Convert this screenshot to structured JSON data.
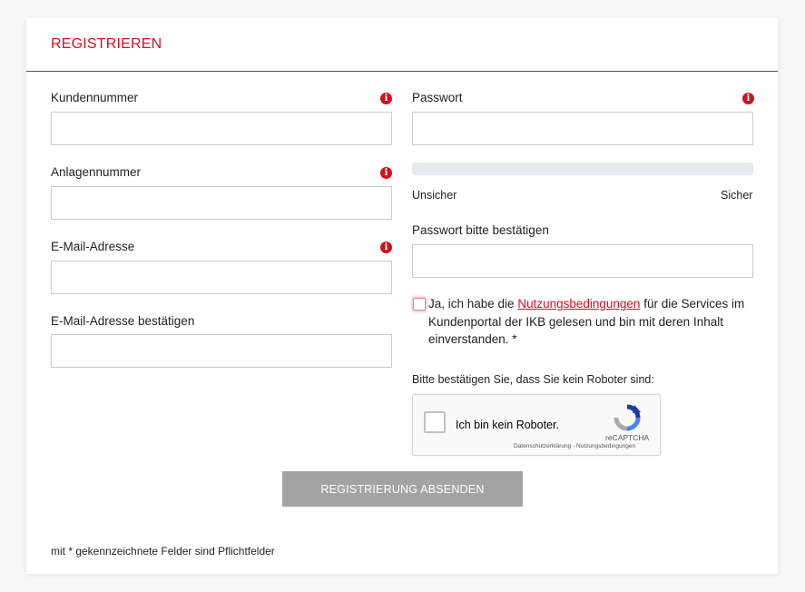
{
  "form": {
    "title": "REGISTRIEREN",
    "customer_number_label": "Kundennummer",
    "plant_number_label": "Anlagennummer",
    "email_label": "E-Mail-Adresse",
    "email_confirm_label": "E-Mail-Adresse bestätigen",
    "password_label": "Passwort",
    "strength_low": "Unsicher",
    "strength_high": "Sicher",
    "password_confirm_label": "Passwort bitte bestätigen",
    "terms_prefix": "Ja, ich habe die ",
    "terms_link": "Nutzungsbedingungen",
    "terms_suffix": " für die Services im Kundenportal der IKB gelesen und bin mit deren Inhalt einverstanden. *",
    "robot_prompt": "Bitte bestätigen Sie, dass Sie kein Roboter sind:",
    "submit_label": "REGISTRIERUNG ABSENDEN",
    "footnote": "mit * gekennzeichnete Felder sind Pflichtfelder",
    "info_glyph": "i"
  },
  "captcha": {
    "label": "Ich bin kein Roboter.",
    "brand": "reCAPTCHA",
    "privacy_link": "Datenschutzerklärung",
    "separator": " - ",
    "terms_link": "Nutzungsbedingungen"
  },
  "colors": {
    "accent": "#d1101d",
    "button": "#a3a3a3",
    "strength_track": "#e6e9ed"
  }
}
